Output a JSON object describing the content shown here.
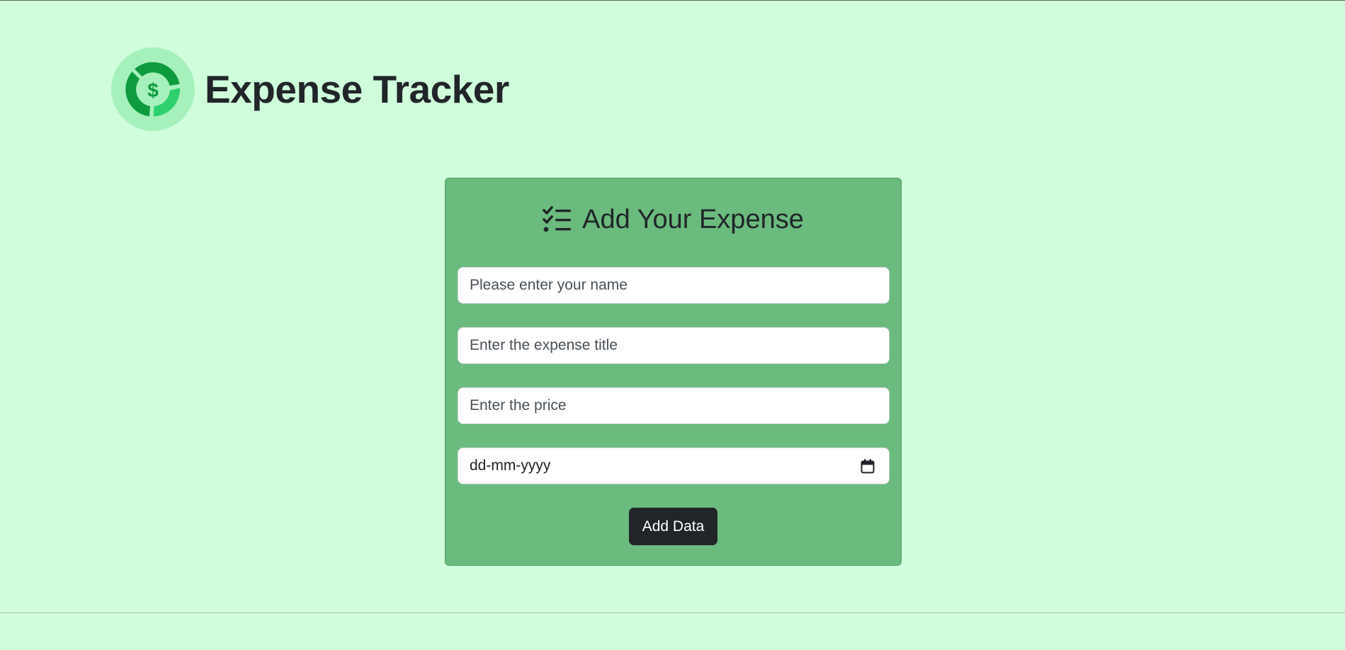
{
  "app": {
    "title": "Expense Tracker",
    "logo_icon": "dollar-ring-logo-icon"
  },
  "form": {
    "heading": "Add Your Expense",
    "heading_icon": "checklist-icon",
    "name_placeholder": "Please enter your name",
    "title_placeholder": "Enter the expense title",
    "price_placeholder": "Enter the price",
    "date_placeholder": "dd-mm-yyyy",
    "date_icon": "calendar-icon",
    "submit_label": "Add Data"
  },
  "colors": {
    "page_background": "#d0fedc",
    "card_background": "#6abb7d",
    "button_background": "#212529",
    "logo_dark": "#0d9b3e",
    "logo_light": "#2ed06d",
    "logo_ring": "#a6f0bc"
  }
}
